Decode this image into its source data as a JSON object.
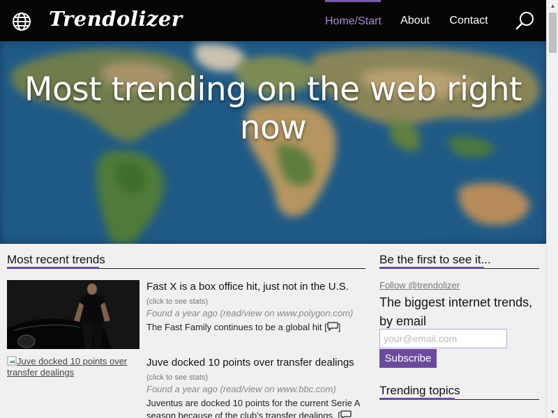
{
  "nav": {
    "brand": "Trendolizer",
    "items": [
      {
        "label": "Home/Start",
        "active": true
      },
      {
        "label": "About",
        "active": false
      },
      {
        "label": "Contact",
        "active": false
      }
    ],
    "icons": {
      "logo": "globe-icon",
      "search": "search-icon"
    },
    "active_color": "#a78ad6"
  },
  "hero": {
    "title": "Most trending on the web right now"
  },
  "main": {
    "heading": "Most recent trends",
    "entries": [
      {
        "title": "Fast X is a box office hit, just not in the U.S.",
        "hint": "(click to see stats)",
        "meta": "Found a year ago (read/view on www.polygon.com)",
        "description": "The Fast Family continues to be a global hit [",
        "description_end": "]"
      },
      {
        "image_alt": "Juve docked 10 points over transfer dealings",
        "title": "Juve docked 10 points over transfer dealings",
        "hint": "(click to see stats)",
        "meta": "Found a year ago (read/view on www.bbc.com)",
        "description": "Juventus are docked 10 points for the current Serie A season because of the club's transfer dealings. ["
      }
    ]
  },
  "sidebar": {
    "heading": "Be the first to see it...",
    "follow_link": "Follow @trendolizer",
    "title": "The biggest internet trends, by email",
    "email_placeholder": "your@email.com",
    "subscribe_label": "Subscribe",
    "topics_heading": "Trending topics"
  },
  "colors": {
    "accent": "#6b4a9c",
    "nav_bg": "#050505"
  }
}
